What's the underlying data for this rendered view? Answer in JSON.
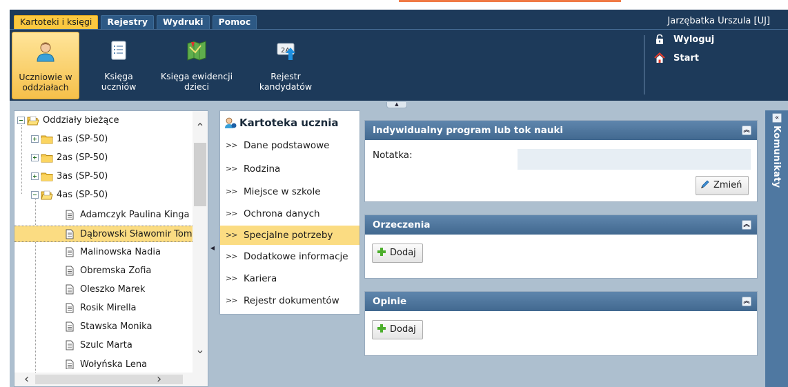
{
  "header": {
    "menu_tabs": [
      "Kartoteki i księgi",
      "Rejestry",
      "Wydruki",
      "Pomoc"
    ],
    "user": "Jarzębatka Urszula [UJ]",
    "ribbon": [
      {
        "label": "Uczniowie w oddziałach",
        "icon": "student-icon"
      },
      {
        "label": "Księga uczniów",
        "icon": "book-list-icon"
      },
      {
        "label": "Księga ewidencji dzieci",
        "icon": "map-register-icon"
      },
      {
        "label": "Rejestr kandydatów",
        "icon": "candidate-register-icon"
      }
    ],
    "links": {
      "logout": "Wyloguj",
      "start": "Start"
    },
    "colors": {
      "header_bg": "#1d3a5a",
      "active_tab": "#fbc840",
      "selection": "#fbdc82",
      "panel_header": "#4f78a1"
    }
  },
  "tree": {
    "root": "Oddziały bieżące",
    "classes": [
      "1as (SP-50)",
      "2as (SP-50)",
      "3as (SP-50)",
      "4as (SP-50)"
    ],
    "students": [
      "Adamczyk Paulina Kinga",
      "Dąbrowski Sławomir Tomasz",
      "Malinowska Nadia",
      "Obremska Zofia",
      "Oleszko Marek",
      "Rosik Mirella",
      "Stawska Monika",
      "Szulc Marta",
      "Wołyńska Lena"
    ],
    "selected_student": "Dąbrowski Sławomir Tomasz"
  },
  "menu": {
    "title": "Kartoteka ucznia",
    "items": [
      "Dane podstawowe",
      "Rodzina",
      "Miejsce w szkole",
      "Ochrona danych",
      "Specjalne potrzeby",
      "Dodatkowe informacje",
      "Kariera",
      "Rejestr dokumentów"
    ],
    "selected": "Specjalne potrzeby"
  },
  "panels": {
    "program": {
      "title": "Indywidualny program lub tok nauki",
      "note_label": "Notatka:",
      "note_value": "",
      "button": "Zmień"
    },
    "orzeczenia": {
      "title": "Orzeczenia",
      "button": "Dodaj"
    },
    "opinie": {
      "title": "Opinie",
      "button": "Dodaj"
    }
  },
  "sidebar": {
    "label": "Komunikaty"
  }
}
